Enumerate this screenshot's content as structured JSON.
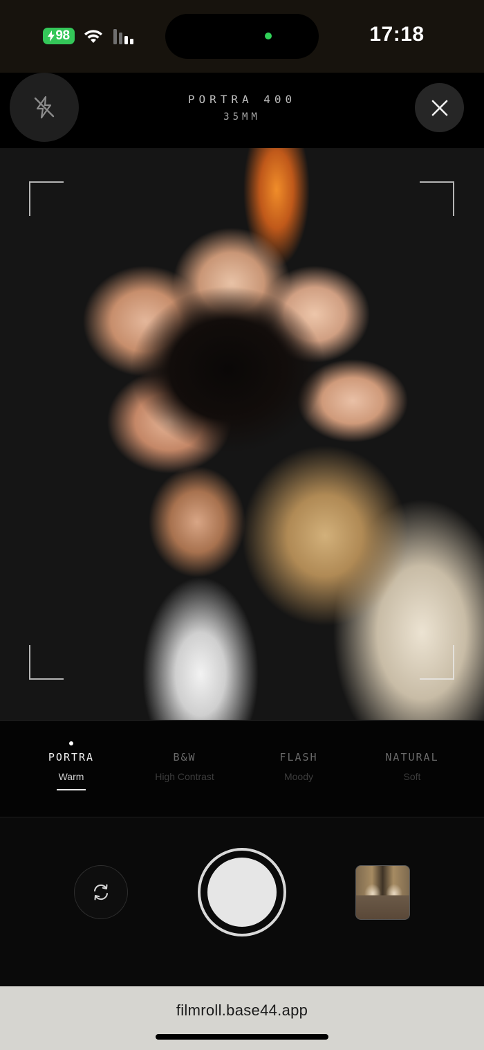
{
  "status_bar": {
    "battery_level": "98",
    "battery_charging": true,
    "time": "17:18",
    "icons": [
      "bolt-icon",
      "wifi-icon",
      "signal-icon"
    ],
    "colors": {
      "battery": "#34c759",
      "camera_indicator": "#30d158"
    }
  },
  "camera": {
    "film_name": "PORTRA 400",
    "film_format": "35MM",
    "flash_icon": "flash-off-icon",
    "close_icon": "close-icon"
  },
  "film_options": [
    {
      "name": "PORTRA",
      "description": "Warm",
      "selected": true
    },
    {
      "name": "B&W",
      "description": "High Contrast",
      "selected": false
    },
    {
      "name": "FLASH",
      "description": "Moody",
      "selected": false
    },
    {
      "name": "NATURAL",
      "description": "Soft",
      "selected": false
    }
  ],
  "controls": {
    "flip_icon": "flip-camera-icon",
    "shutter": "shutter-button",
    "gallery": "gallery-thumbnail"
  },
  "browser": {
    "url": "filmroll.base44.app"
  }
}
